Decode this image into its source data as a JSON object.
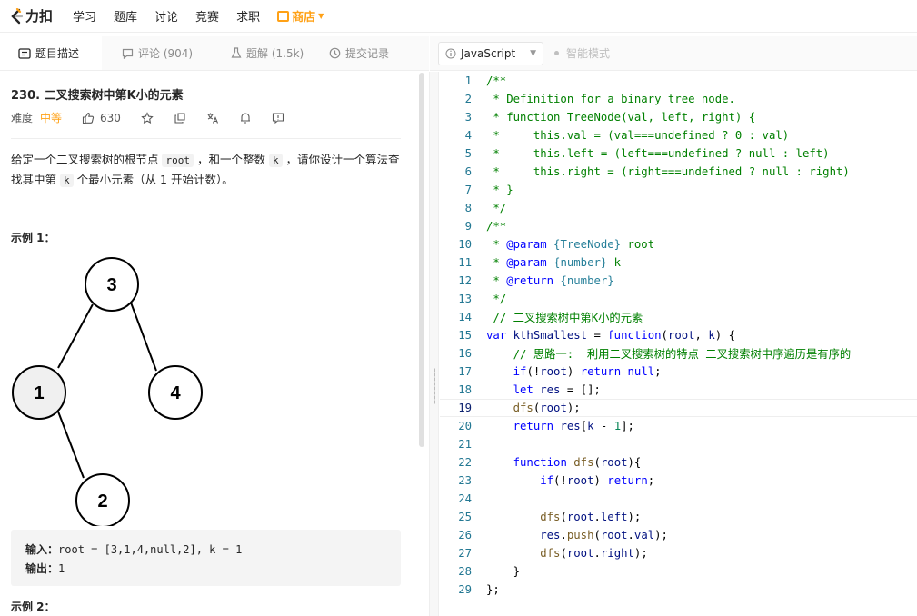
{
  "nav": {
    "logo": "力扣",
    "items": [
      "学习",
      "题库",
      "讨论",
      "竞赛",
      "求职"
    ],
    "shop": "商店"
  },
  "left_tabs": {
    "description": "题目描述",
    "comments": "评论 (904)",
    "solutions": "题解 (1.5k)",
    "submissions": "提交记录"
  },
  "toolbar": {
    "language": "JavaScript",
    "smart_mode": "智能模式"
  },
  "problem": {
    "title": "230. 二叉搜索树中第K小的元素",
    "difficulty_label": "难度",
    "difficulty": "中等",
    "likes": "630",
    "desc_part1": "给定一个二叉搜索树的根节点 ",
    "desc_root": "root",
    "desc_part2": " ，和一个整数 ",
    "desc_k": "k",
    "desc_part3": " ，请你设计一个算法查找其中第 ",
    "desc_k2": "k",
    "desc_part4": " 个最小元素（从 1 开始计数）。",
    "example1_title": "示例 1：",
    "tree_nodes": [
      "3",
      "1",
      "4",
      "2"
    ],
    "input_label": "输入：",
    "input_value": "root = [3,1,4,null,2], k = 1",
    "output_label": "输出：",
    "output_value": "1",
    "example2_title": "示例 2："
  },
  "editor": {
    "current_line": 19,
    "lines": [
      "/**",
      " * Definition for a binary tree node.",
      " * function TreeNode(val, left, right) {",
      " *     this.val = (val===undefined ? 0 : val)",
      " *     this.left = (left===undefined ? null : left)",
      " *     this.right = (right===undefined ? null : right)",
      " * }",
      " */",
      "/**",
      " * @param {TreeNode} root",
      " * @param {number} k",
      " * @return {number}",
      " */",
      " // 二叉搜索树中第K小的元素",
      "var kthSmallest = function(root, k) {",
      "    // 思路一:  利用二叉搜索树的特点 二叉搜索树中序遍历是有序的",
      "    if(!root) return null;",
      "    let res = [];",
      "    dfs(root);",
      "    return res[k - 1];",
      "",
      "    function dfs(root){",
      "        if(!root) return;",
      "",
      "        dfs(root.left);",
      "        res.push(root.val);",
      "        dfs(root.right);",
      "    }",
      "};"
    ]
  }
}
